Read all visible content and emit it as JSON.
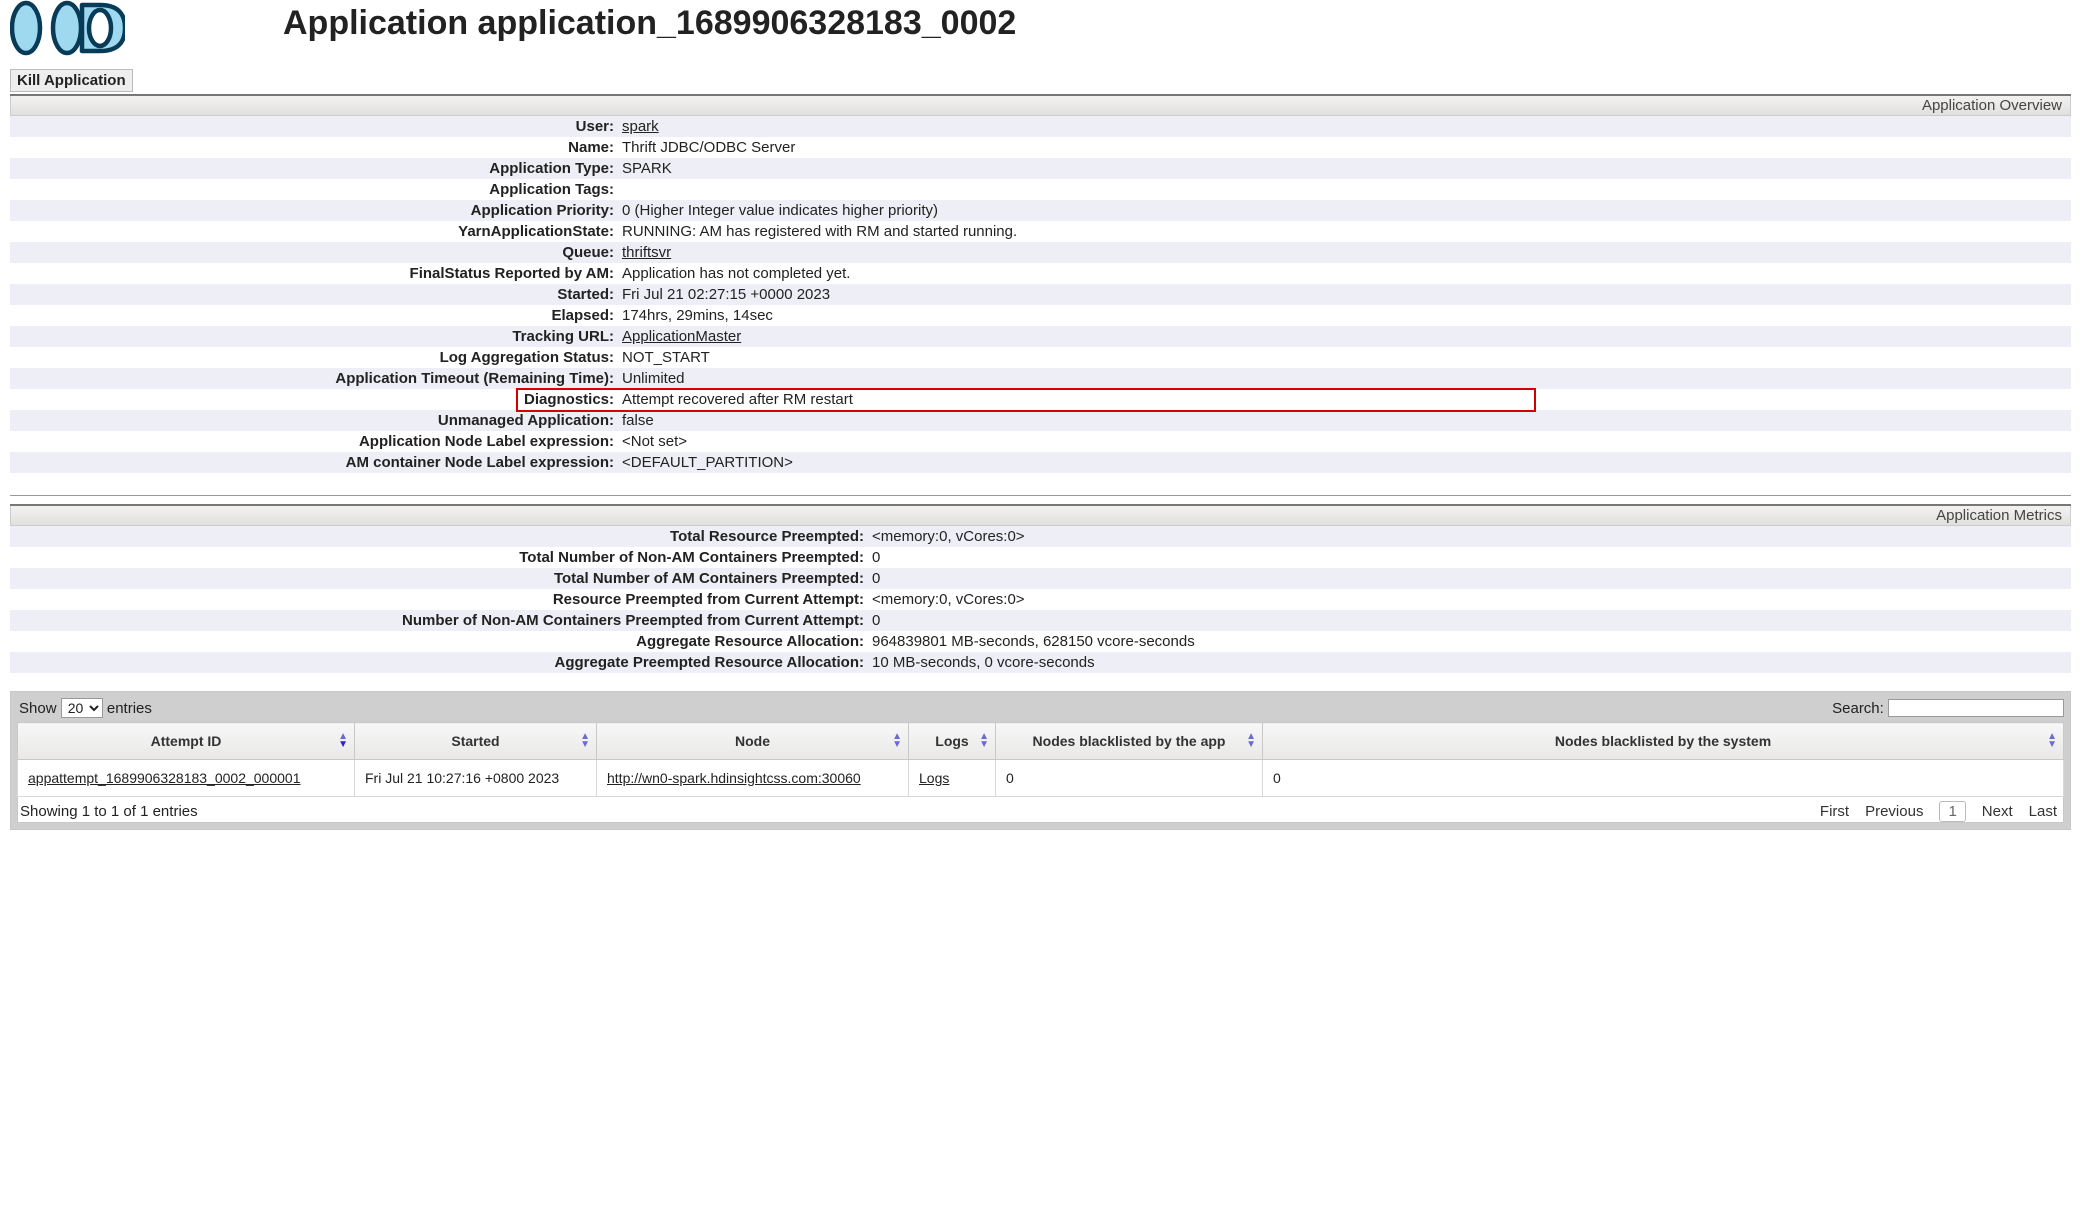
{
  "page_title": "Application application_1689906328183_0002",
  "kill_button_label": "Kill Application",
  "overview_header": "Application Overview",
  "metrics_header": "Application Metrics",
  "overview": [
    {
      "label": "User:",
      "value": "spark",
      "link": true
    },
    {
      "label": "Name:",
      "value": "Thrift JDBC/ODBC Server"
    },
    {
      "label": "Application Type:",
      "value": "SPARK"
    },
    {
      "label": "Application Tags:",
      "value": ""
    },
    {
      "label": "Application Priority:",
      "value": "0 (Higher Integer value indicates higher priority)"
    },
    {
      "label": "YarnApplicationState:",
      "value": "RUNNING: AM has registered with RM and started running."
    },
    {
      "label": "Queue:",
      "value": "thriftsvr",
      "link": true
    },
    {
      "label": "FinalStatus Reported by AM:",
      "value": "Application has not completed yet."
    },
    {
      "label": "Started:",
      "value": "Fri Jul 21 02:27:15 +0000 2023"
    },
    {
      "label": "Elapsed:",
      "value": "174hrs, 29mins, 14sec"
    },
    {
      "label": "Tracking URL:",
      "value": "ApplicationMaster",
      "link": true
    },
    {
      "label": "Log Aggregation Status:",
      "value": "NOT_START"
    },
    {
      "label": "Application Timeout (Remaining Time):",
      "value": "Unlimited"
    },
    {
      "label": "Diagnostics:",
      "value": "Attempt recovered after RM restart",
      "highlight": true
    },
    {
      "label": "Unmanaged Application:",
      "value": "false"
    },
    {
      "label": "Application Node Label expression:",
      "value": "<Not set>"
    },
    {
      "label": "AM container Node Label expression:",
      "value": "<DEFAULT_PARTITION>"
    }
  ],
  "metrics": [
    {
      "label": "Total Resource Preempted:",
      "value": "<memory:0, vCores:0>"
    },
    {
      "label": "Total Number of Non-AM Containers Preempted:",
      "value": "0"
    },
    {
      "label": "Total Number of AM Containers Preempted:",
      "value": "0"
    },
    {
      "label": "Resource Preempted from Current Attempt:",
      "value": "<memory:0, vCores:0>"
    },
    {
      "label": "Number of Non-AM Containers Preempted from Current Attempt:",
      "value": "0"
    },
    {
      "label": "Aggregate Resource Allocation:",
      "value": "964839801 MB-seconds, 628150 vcore-seconds"
    },
    {
      "label": "Aggregate Preempted Resource Allocation:",
      "value": "10 MB-seconds, 0 vcore-seconds"
    }
  ],
  "attempts": {
    "show_label_pre": "Show ",
    "show_value": "20",
    "show_label_post": " entries",
    "search_label": "Search:",
    "search_value": "",
    "columns": [
      "Attempt ID",
      "Started",
      "Node",
      "Logs",
      "Nodes blacklisted by the app",
      "Nodes blacklisted by the system"
    ],
    "row": {
      "attempt_id": "appattempt_1689906328183_0002_000001",
      "started": "Fri Jul 21 10:27:16 +0800 2023",
      "node": "http://wn0-spark.hdinsightcss.com:30060",
      "logs": "Logs",
      "bl_app": "0",
      "bl_sys": "0"
    },
    "info": "Showing 1 to 1 of 1 entries",
    "pager": {
      "first": "First",
      "previous": "Previous",
      "page": "1",
      "next": "Next",
      "last": "Last"
    }
  }
}
